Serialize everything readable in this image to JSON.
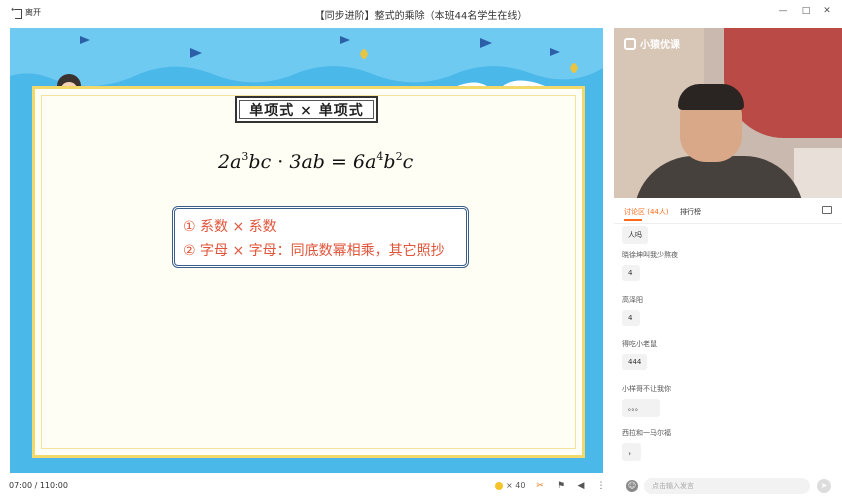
{
  "titlebar": {
    "leave_label": "离开",
    "title": "【同步进阶】整式的乘除（本班44名学生在线）",
    "minimize": "—",
    "restore": "□",
    "close": "✕"
  },
  "slide": {
    "heading": "单项式 × 单项式",
    "formula": {
      "lhs_coef": "2",
      "lhs_a_exp": "3",
      "lhs_rest": "bc",
      "dot": "·",
      "rhs_part": "3ab",
      "eq": "=",
      "res_coef": "6",
      "res_a_exp": "4",
      "res_b_exp": "2",
      "res_c": "c"
    },
    "rules": [
      "① 系数 × 系数",
      "② 字母 × 字母：同底数幂相乘，其它照抄"
    ]
  },
  "video": {
    "logo_text": "小猿优课"
  },
  "tabs": {
    "discussion": "讨论区 (44人)",
    "ranking": "排行榜"
  },
  "chat": {
    "top_bubble": "人吗",
    "messages": [
      {
        "name": "晓徐坤叫我少熬夜",
        "text": "4"
      },
      {
        "name": "高泽阳",
        "text": "4"
      },
      {
        "name": "得吃小老鼠",
        "text": "444"
      },
      {
        "name": "小样哥不让我你",
        "text": "。。。"
      },
      {
        "name": "西拉和一马尔福",
        "text": "，"
      }
    ],
    "input_placeholder": "点击输入发言"
  },
  "bottom": {
    "time": "07:00 /  110:00",
    "coin_count": "× 40"
  },
  "colors": {
    "accent": "#ff6a1a",
    "slide_bg": "#4bb8ea",
    "rule_text": "#e0543a"
  }
}
